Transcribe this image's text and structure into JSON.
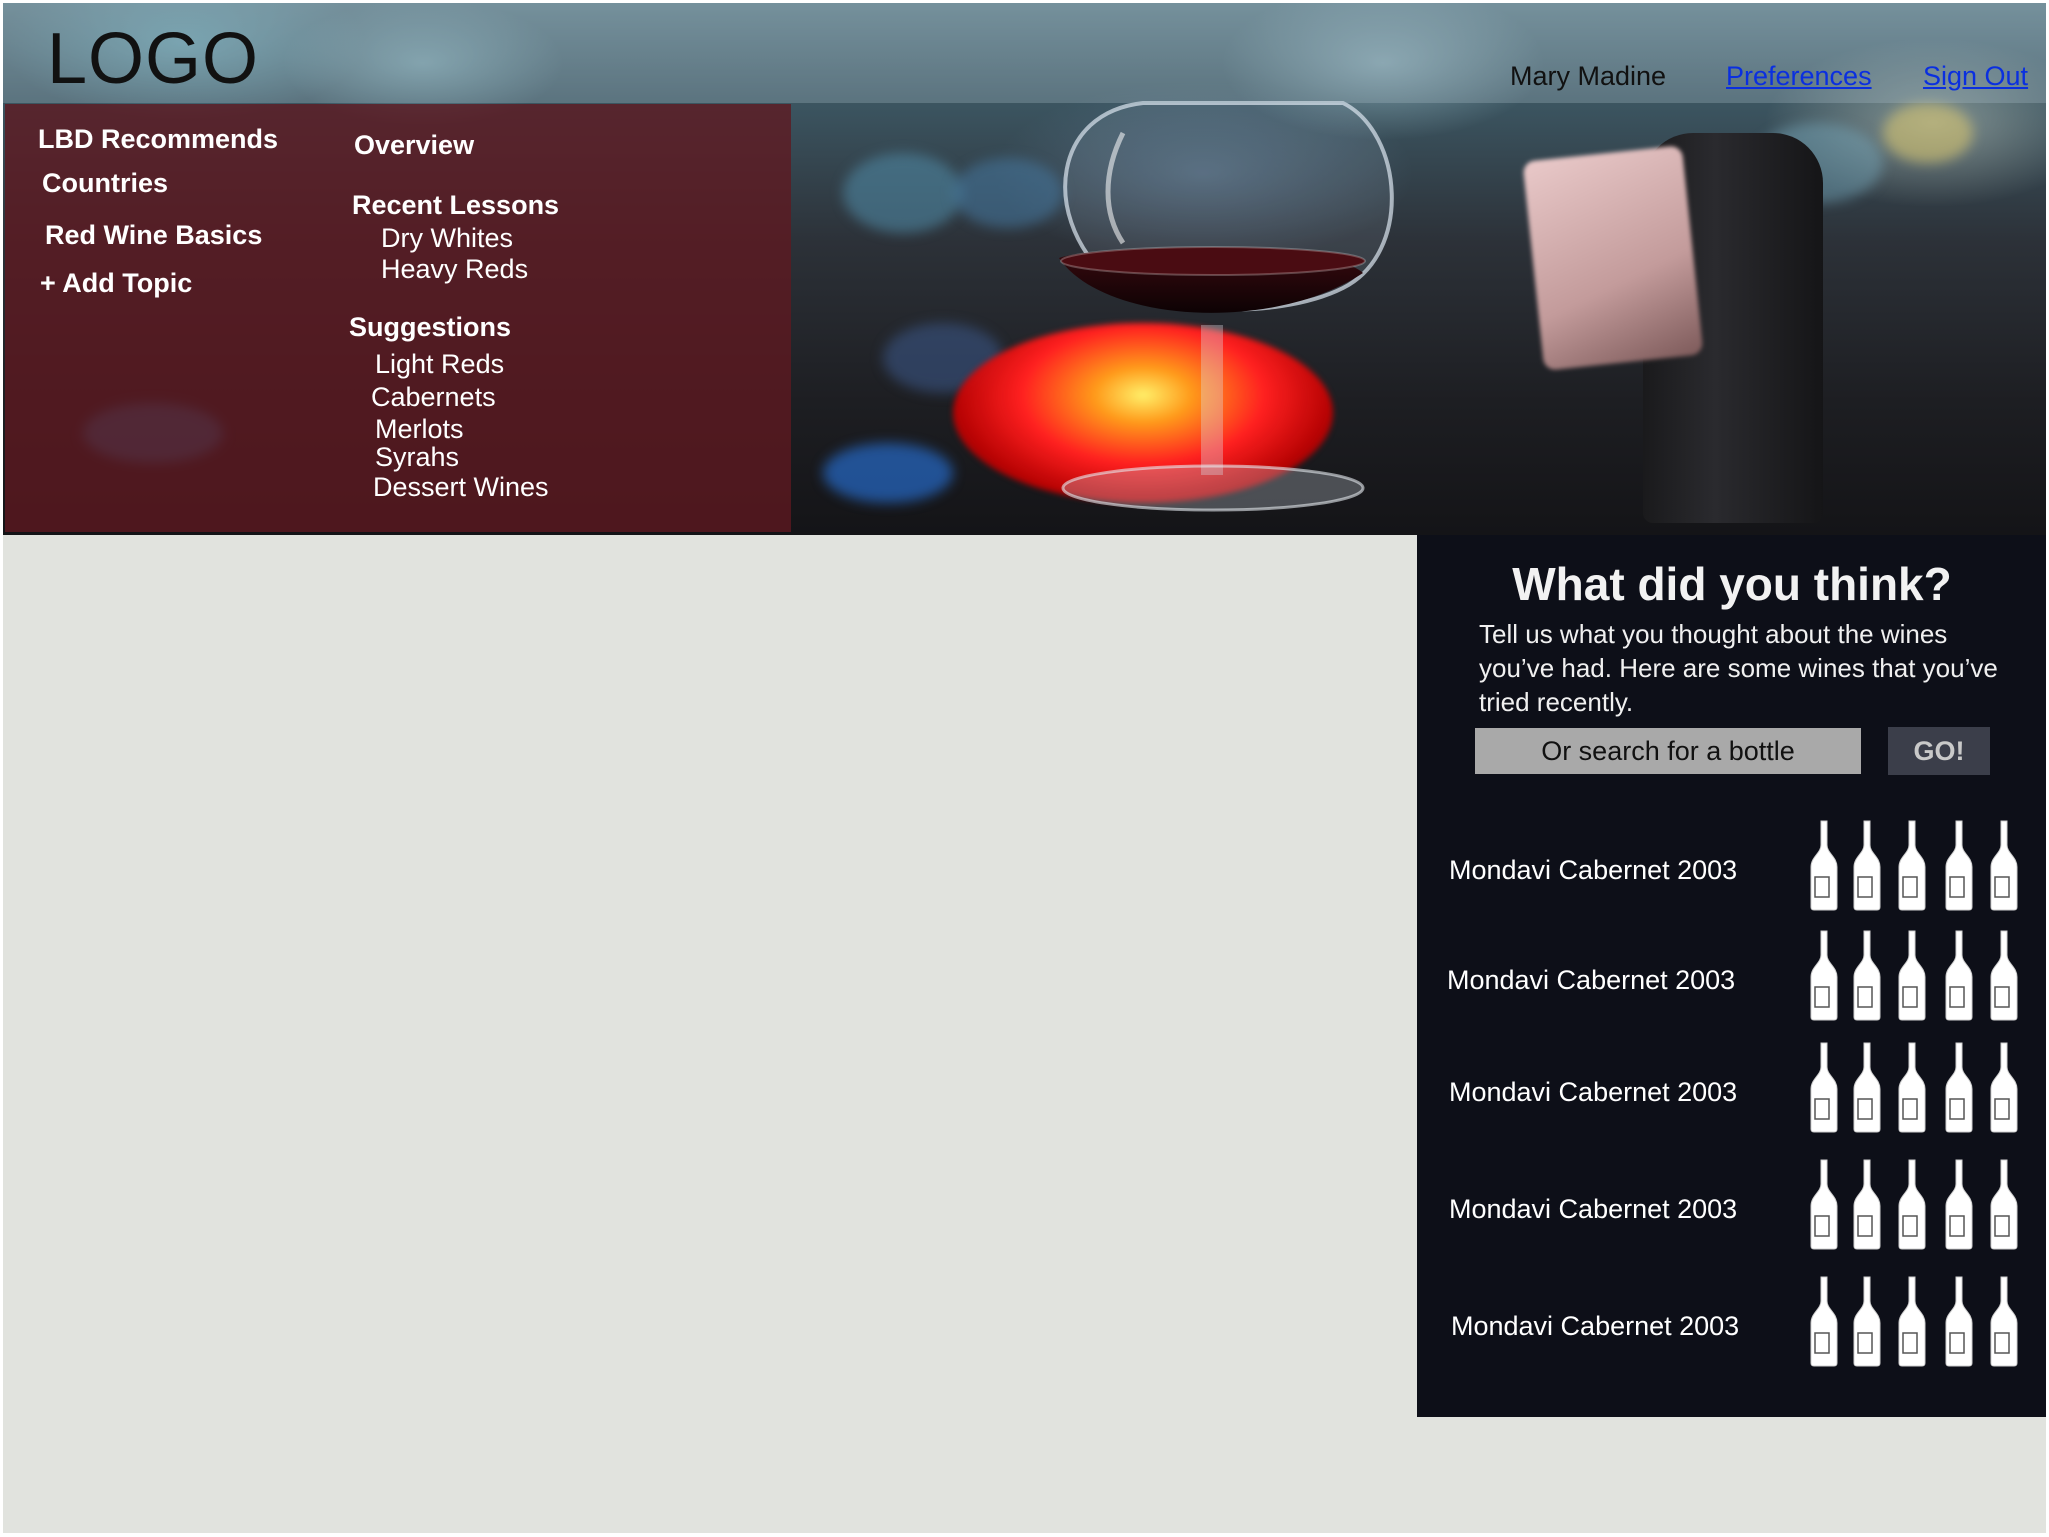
{
  "header": {
    "logo": "LOGO",
    "user_name": "Mary Madine",
    "preferences_label": "Preferences",
    "sign_out_label": "Sign Out"
  },
  "nav": {
    "topics": [
      "LBD Recommends",
      "Countries",
      "Red Wine Basics",
      "+ Add Topic"
    ],
    "overview_label": "Overview",
    "recent_lessons": {
      "heading": "Recent Lessons",
      "items": [
        "Dry Whites",
        "Heavy Reds"
      ]
    },
    "suggestions": {
      "heading": "Suggestions",
      "items": [
        "Light Reds",
        "Cabernets",
        "Merlots",
        "Syrahs",
        "Dessert Wines"
      ]
    }
  },
  "feedback": {
    "title": "What did you think?",
    "description": "Tell us what you thought about the wines you’ve had. Here are some wines that you’ve tried recently.",
    "search_placeholder": "Or search for a bottle",
    "go_label": "GO!",
    "wines": [
      {
        "name": "Mondavi Cabernet 2003",
        "rating_max": 5
      },
      {
        "name": "Mondavi Cabernet 2003",
        "rating_max": 5
      },
      {
        "name": "Mondavi Cabernet 2003",
        "rating_max": 5
      },
      {
        "name": "Mondavi Cabernet 2003",
        "rating_max": 5
      },
      {
        "name": "Mondavi Cabernet 2003",
        "rating_max": 5
      }
    ]
  },
  "icons": {
    "rating": "wine-bottle-icon"
  },
  "colors": {
    "nav_overlay": "#5f1820",
    "feedback_bg": "#0d0f18",
    "link": "#0a2fe0",
    "content_bg": "#e1e3de"
  }
}
